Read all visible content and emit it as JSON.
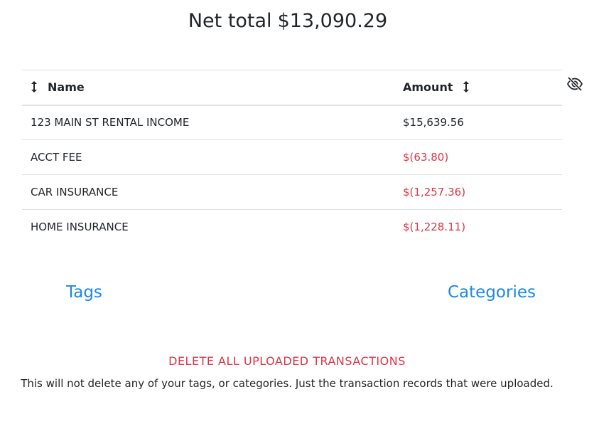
{
  "summary": {
    "label": "Net total",
    "value": "$13,090.29"
  },
  "table": {
    "columns": {
      "name": "Name",
      "amount": "Amount"
    },
    "rows": [
      {
        "name": "123 MAIN ST RENTAL INCOME",
        "amount": "$15,639.56",
        "negative": false
      },
      {
        "name": "ACCT FEE",
        "amount": "$(63.80)",
        "negative": true
      },
      {
        "name": "CAR INSURANCE",
        "amount": "$(1,257.36)",
        "negative": true
      },
      {
        "name": "HOME INSURANCE",
        "amount": "$(1,228.11)",
        "negative": true
      }
    ]
  },
  "icons": {
    "sort": "sort-arrows-icon",
    "visibility": "eye-slash-icon"
  },
  "links": {
    "tags": "Tags",
    "categories": "Categories"
  },
  "danger": {
    "delete_label": "DELETE ALL UPLOADED TRANSACTIONS",
    "note": "This will not delete any of your tags, or categories. Just the transaction records that were uploaded."
  },
  "colors": {
    "text": "#212529",
    "negative": "#dc3545",
    "link": "#1e88e5",
    "border": "#dee2e6"
  }
}
